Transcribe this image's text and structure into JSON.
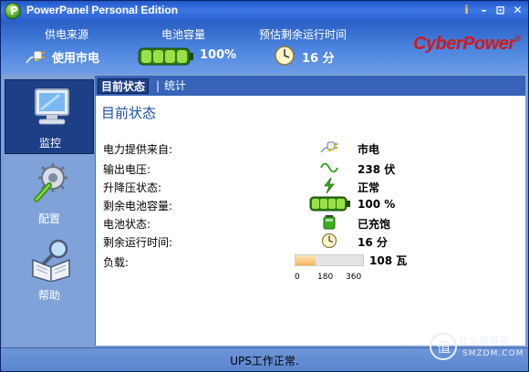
{
  "window": {
    "title": "PowerPanel Personal Edition",
    "app_icon_letter": "P"
  },
  "titlebar_buttons": {
    "info": "i",
    "minimize": "–",
    "restore": "⊡",
    "close": "✕"
  },
  "header": {
    "power_source_label": "供电来源",
    "power_source_value": "使用市电",
    "battery_label": "电池容量",
    "battery_value": "100%",
    "runtime_label": "预估剩余运行时间",
    "runtime_value": "16 分",
    "brand": "CyberPower",
    "brand_mark": "®"
  },
  "nav": {
    "items": [
      {
        "label": "监控",
        "icon": "monitor-icon",
        "active": true
      },
      {
        "label": "配置",
        "icon": "config-gear-icon",
        "active": false
      },
      {
        "label": "帮助",
        "icon": "help-book-icon",
        "active": false
      }
    ]
  },
  "tabs": [
    {
      "label": "目前状态",
      "active": true
    },
    {
      "label": "统计",
      "active": false
    }
  ],
  "tab_separator": "|",
  "page_title": "目前状态",
  "status_rows": [
    {
      "label": "电力提供来自:",
      "value": "市电",
      "icon": "plug-icon"
    },
    {
      "label": "输出电压:",
      "value": "238 伏",
      "icon": "sine-wave-icon"
    },
    {
      "label": "升降压状态:",
      "value": "正常",
      "icon": "lightning-icon"
    },
    {
      "label": "剩余电池容量:",
      "value": "100 %",
      "icon": "battery-icon"
    },
    {
      "label": "电池状态:",
      "value": "已充饱",
      "icon": "battery-charged-icon"
    },
    {
      "label": "剩余运行时间:",
      "value": "16 分",
      "icon": "clock-icon"
    }
  ],
  "load": {
    "label": "负载:",
    "value": "108 瓦",
    "watts": 108,
    "max": 360,
    "ticks": [
      "0",
      "180",
      "360"
    ]
  },
  "statusbar": {
    "text": "UPS工作正常."
  },
  "watermark": {
    "logo": "值",
    "line1": "什么值得买",
    "line2": "SMZDM.COM"
  },
  "colors": {
    "accent": "#1d3f86",
    "brand": "#d41818",
    "title_blue": "#1d4ea8"
  }
}
